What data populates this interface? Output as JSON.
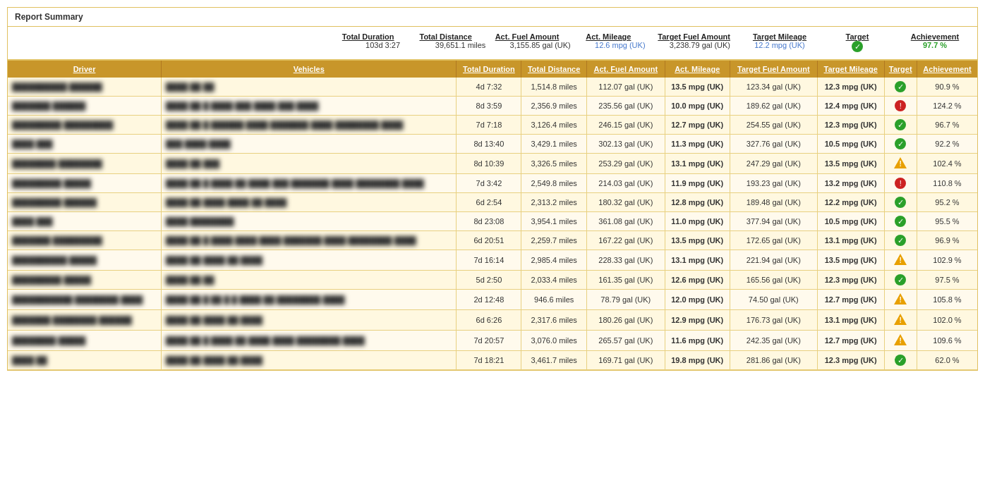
{
  "report": {
    "title": "Report Summary",
    "summary": {
      "columns": [
        {
          "header": "Total Duration",
          "value": "103d 3:27",
          "valueClass": "normal"
        },
        {
          "header": "Total Distance",
          "value": "39,651.1 miles",
          "valueClass": "normal"
        },
        {
          "header": "Act. Fuel Amount",
          "value": "3,155.85 gal (UK)",
          "valueClass": "normal"
        },
        {
          "header": "Act. Mileage",
          "value": "12.6 mpg (UK)",
          "valueClass": "blue"
        },
        {
          "header": "Target Fuel Amount",
          "value": "3,238.79 gal (UK)",
          "valueClass": "normal"
        },
        {
          "header": "Target Mileage",
          "value": "12.2 mpg (UK)",
          "valueClass": "blue"
        },
        {
          "header": "Target",
          "value": "✓",
          "valueClass": "icon-green"
        },
        {
          "header": "Achievement",
          "value": "97.7 %",
          "valueClass": "green"
        }
      ]
    },
    "table": {
      "headers": [
        "Driver",
        "Vehicles",
        "Total Duration",
        "Total Distance",
        "Act. Fuel Amount",
        "Act. Mileage",
        "Target Fuel Amount",
        "Target Mileage",
        "Target",
        "Achievement"
      ],
      "rows": [
        {
          "driver": "██████████ ██████",
          "vehicles": "████ ██ ██",
          "duration": "4d 7:32",
          "distance": "1,514.8 miles",
          "actFuel": "112.07 gal (UK)",
          "actMileage": "13.5 mpg (UK)",
          "targetFuel": "123.34 gal (UK)",
          "targetMileage": "12.3 mpg (UK)",
          "target": "green",
          "achievement": "90.9 %"
        },
        {
          "driver": "███████ ██████",
          "vehicles": "████ ██ █ ████ ███ ████ ███ ████",
          "duration": "8d 3:59",
          "distance": "2,356.9 miles",
          "actFuel": "235.56 gal (UK)",
          "actMileage": "10.0 mpg (UK)",
          "targetFuel": "189.62 gal (UK)",
          "targetMileage": "12.4 mpg (UK)",
          "target": "red",
          "achievement": "124.2 %"
        },
        {
          "driver": "█████████ █████████",
          "vehicles": "████ ██ █ ██████ ████ ███████ ████ ████████ ████",
          "duration": "7d 7:18",
          "distance": "3,126.4 miles",
          "actFuel": "246.15 gal (UK)",
          "actMileage": "12.7 mpg (UK)",
          "targetFuel": "254.55 gal (UK)",
          "targetMileage": "12.3 mpg (UK)",
          "target": "green",
          "achievement": "96.7 %"
        },
        {
          "driver": "████ ███",
          "vehicles": "███ ████ ████",
          "duration": "8d 13:40",
          "distance": "3,429.1 miles",
          "actFuel": "302.13 gal (UK)",
          "actMileage": "11.3 mpg (UK)",
          "targetFuel": "327.76 gal (UK)",
          "targetMileage": "10.5 mpg (UK)",
          "target": "green",
          "achievement": "92.2 %"
        },
        {
          "driver": "████████ ████████",
          "vehicles": "████ ██ ███",
          "duration": "8d 10:39",
          "distance": "3,326.5 miles",
          "actFuel": "253.29 gal (UK)",
          "actMileage": "13.1 mpg (UK)",
          "targetFuel": "247.29 gal (UK)",
          "targetMileage": "13.5 mpg (UK)",
          "target": "yellow",
          "achievement": "102.4 %"
        },
        {
          "driver": "█████████ █████",
          "vehicles": "████ ██ █ ████ ██ ████ ███ ███████ ████ ████████ ████",
          "duration": "7d 3:42",
          "distance": "2,549.8 miles",
          "actFuel": "214.03 gal (UK)",
          "actMileage": "11.9 mpg (UK)",
          "targetFuel": "193.23 gal (UK)",
          "targetMileage": "13.2 mpg (UK)",
          "target": "red",
          "achievement": "110.8 %"
        },
        {
          "driver": "█████████ ██████",
          "vehicles": "████ ██ ████ ████ ██ ████",
          "duration": "6d 2:54",
          "distance": "2,313.2 miles",
          "actFuel": "180.32 gal (UK)",
          "actMileage": "12.8 mpg (UK)",
          "targetFuel": "189.48 gal (UK)",
          "targetMileage": "12.2 mpg (UK)",
          "target": "green",
          "achievement": "95.2 %"
        },
        {
          "driver": "████ ███",
          "vehicles": "████ ████████",
          "duration": "8d 23:08",
          "distance": "3,954.1 miles",
          "actFuel": "361.08 gal (UK)",
          "actMileage": "11.0 mpg (UK)",
          "targetFuel": "377.94 gal (UK)",
          "targetMileage": "10.5 mpg (UK)",
          "target": "green",
          "achievement": "95.5 %"
        },
        {
          "driver": "███████ █████████",
          "vehicles": "████ ██ █ ████ ████ ████ ███████ ████ ████████ ████",
          "duration": "6d 20:51",
          "distance": "2,259.7 miles",
          "actFuel": "167.22 gal (UK)",
          "actMileage": "13.5 mpg (UK)",
          "targetFuel": "172.65 gal (UK)",
          "targetMileage": "13.1 mpg (UK)",
          "target": "green",
          "achievement": "96.9 %"
        },
        {
          "driver": "██████████ █████",
          "vehicles": "████ ██ ████ ██ ████",
          "duration": "7d 16:14",
          "distance": "2,985.4 miles",
          "actFuel": "228.33 gal (UK)",
          "actMileage": "13.1 mpg (UK)",
          "targetFuel": "221.94 gal (UK)",
          "targetMileage": "13.5 mpg (UK)",
          "target": "yellow",
          "achievement": "102.9 %"
        },
        {
          "driver": "█████████ █████",
          "vehicles": "████ ██ ██",
          "duration": "5d 2:50",
          "distance": "2,033.4 miles",
          "actFuel": "161.35 gal (UK)",
          "actMileage": "12.6 mpg (UK)",
          "targetFuel": "165.56 gal (UK)",
          "targetMileage": "12.3 mpg (UK)",
          "target": "green",
          "achievement": "97.5 %"
        },
        {
          "driver": "███████████ ████████ ████",
          "vehicles": "████ ██ █ ██ █ █ ████ ██ ████████ ████",
          "duration": "2d 12:48",
          "distance": "946.6 miles",
          "actFuel": "78.79 gal (UK)",
          "actMileage": "12.0 mpg (UK)",
          "targetFuel": "74.50 gal (UK)",
          "targetMileage": "12.7 mpg (UK)",
          "target": "yellow",
          "achievement": "105.8 %"
        },
        {
          "driver": "███████ ████████ ██████",
          "vehicles": "████ ██ ████ ██ ████",
          "duration": "6d 6:26",
          "distance": "2,317.6 miles",
          "actFuel": "180.26 gal (UK)",
          "actMileage": "12.9 mpg (UK)",
          "targetFuel": "176.73 gal (UK)",
          "targetMileage": "13.1 mpg (UK)",
          "target": "yellow",
          "achievement": "102.0 %"
        },
        {
          "driver": "████████ █████",
          "vehicles": "████ ██ █ ████ ██ ████ ████ ████████ ████",
          "duration": "7d 20:57",
          "distance": "3,076.0 miles",
          "actFuel": "265.57 gal (UK)",
          "actMileage": "11.6 mpg (UK)",
          "targetFuel": "242.35 gal (UK)",
          "targetMileage": "12.7 mpg (UK)",
          "target": "yellow",
          "achievement": "109.6 %"
        },
        {
          "driver": "████ ██",
          "vehicles": "████ ██ ████ ██ ████",
          "duration": "7d 18:21",
          "distance": "3,461.7 miles",
          "actFuel": "169.71 gal (UK)",
          "actMileage": "19.8 mpg (UK)",
          "targetFuel": "281.86 gal (UK)",
          "targetMileage": "12.3 mpg (UK)",
          "target": "green",
          "achievement": "62.0 %"
        }
      ]
    }
  }
}
